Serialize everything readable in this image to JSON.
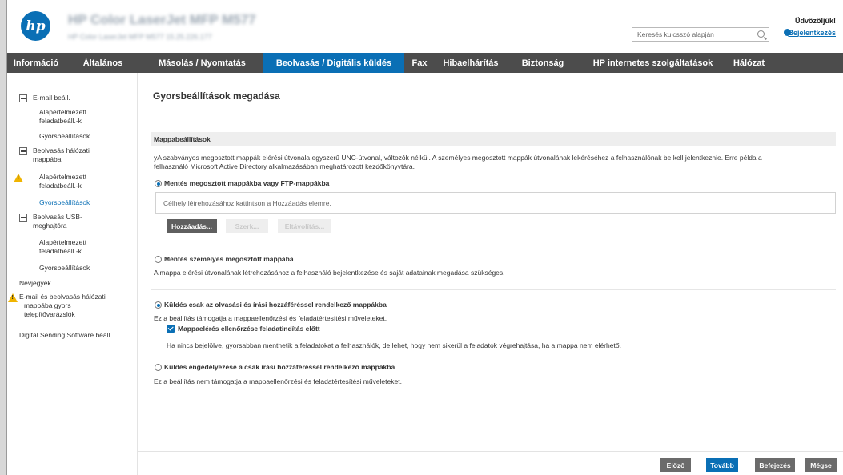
{
  "header": {
    "device_title": "HP Color LaserJet MFP M577",
    "device_subtitle": "HP Color LaserJet MFP M577    15.25.226.177",
    "search_placeholder": "Keresés kulcsszó alapján",
    "welcome": "Üdvözöljük!",
    "login": "Bejelentkezés"
  },
  "nav": {
    "items": [
      {
        "label": "Információ"
      },
      {
        "label": "Általános"
      },
      {
        "label": "Másolás / Nyomtatás"
      },
      {
        "label": "Beolvasás / Digitális küldés"
      },
      {
        "label": "Fax"
      },
      {
        "label": "Hibaelhárítás"
      },
      {
        "label": "Biztonság"
      },
      {
        "label": "HP internetes szolgáltatások"
      },
      {
        "label": "Hálózat"
      }
    ],
    "active": "Beolvasás / Digitális küldés"
  },
  "sidebar": {
    "email_group": "E-mail beáll.",
    "email_default": [
      "Alapértelmezett",
      "feladatbeáll.-k"
    ],
    "email_quick": "Gyorsbeállítások",
    "network_group": [
      "Beolvasás hálózati",
      "mappába"
    ],
    "network_default": [
      "Alapértelmezett",
      "feladatbeáll.-k"
    ],
    "network_quick": "Gyorsbeállítások",
    "usb_group": [
      "Beolvasás USB-",
      "meghajtóra"
    ],
    "usb_default": [
      "Alapértelmezett",
      "feladatbeáll.-k"
    ],
    "usb_quick": "Gyorsbeállítások",
    "contacts": "Névjegyek",
    "wizard": [
      "E-mail és beolvasás hálózati",
      "mappába gyors",
      "telepítővarázslók"
    ],
    "dss": "Digital Sending Software beáll."
  },
  "main": {
    "page_title": "Gyorsbeállítások megadása",
    "section_title": "Mappabeállítások",
    "intro": [
      "yA szabványos megosztott mappák elérési útvonala egyszerű UNC-útvonal, változók nélkül. A személyes megosztott mappák útvonalának lekéréséhez a felhasználónak be kell jelentkeznie. Erre példa a",
      "felhasználó Microsoft Active Directory alkalmazásában meghatározott kezdőkönyvtára."
    ],
    "option_shared": "Mentés megosztott mappákba vagy FTP-mappákba",
    "destination_placeholder": "Célhely létrehozásához kattintson a Hozzáadás elemre.",
    "btn_add": "Hozzáadás...",
    "btn_edit": "Szerk...",
    "btn_remove": "Eltávolítás...",
    "option_personal": "Mentés személyes megosztott mappába",
    "personal_desc": "A mappa elérési útvonalának létrehozásához a felhasználó bejelentkezése és saját adatainak megadása szükséges.",
    "option_readwrite": "Küldés csak az olvasási és írási hozzáféréssel rendelkező mappákba",
    "readwrite_desc": "Ez a beállítás támogatja a mappaellenőrzési és feladatértesítési műveleteket.",
    "verify_label": "Mappaelérés ellenőrzése feladatindítás előtt",
    "verify_desc": "Ha nincs bejelölve, gyorsabban menthetik a feladatokat a felhasználók, de lehet, hogy nem sikerül a feladatok végrehajtása, ha a mappa nem elérhető.",
    "option_writeonly": "Küldés engedélyezése a csak írási hozzáféréssel rendelkező mappákba",
    "writeonly_desc": "Ez a beállítás nem támogatja a mappaellenőrzési és feladatértesítési műveleteket."
  },
  "footer": {
    "prev": "Előző",
    "next": "Tovább",
    "finish": "Befejezés",
    "cancel": "Mégse"
  }
}
